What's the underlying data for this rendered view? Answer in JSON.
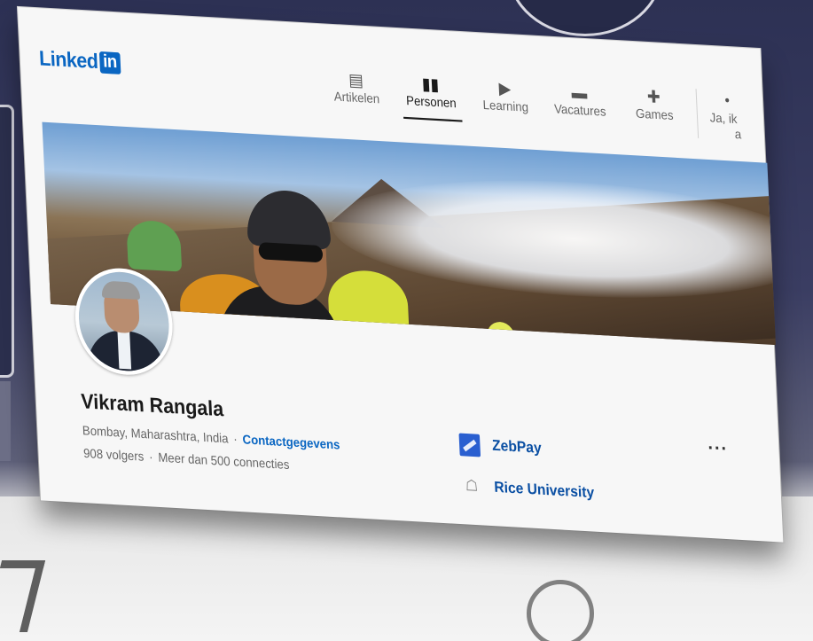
{
  "header": {
    "logo_text": "Linked",
    "logo_box": "in"
  },
  "nav": {
    "items": [
      {
        "label": "Artikelen",
        "icon": "articles-icon",
        "active": false
      },
      {
        "label": "Personen",
        "icon": "people-icon",
        "active": true
      },
      {
        "label": "Learning",
        "icon": "learning-icon",
        "active": false
      },
      {
        "label": "Vacatures",
        "icon": "jobs-icon",
        "active": false
      },
      {
        "label": "Games",
        "icon": "games-icon",
        "active": false
      }
    ],
    "more_label_line1": "Ja, ik",
    "more_label_line2": "a"
  },
  "profile": {
    "name": "Vikram Rangala",
    "location": "Bombay, Maharashtra, India",
    "separator": "·",
    "contact_link": "Contactgegevens",
    "followers": "908 volgers",
    "connections": "Meer dan 500 connecties",
    "more_button": "···"
  },
  "experience": [
    {
      "name": "ZebPay",
      "icon": "zebpay-logo-icon"
    },
    {
      "name": "Rice University",
      "icon": "rice-university-logo-icon"
    }
  ],
  "colors": {
    "brand_blue": "#0a66c2",
    "link_blue": "#0a4fa3",
    "text_primary": "#1a1a1a",
    "text_secondary": "#666666"
  }
}
